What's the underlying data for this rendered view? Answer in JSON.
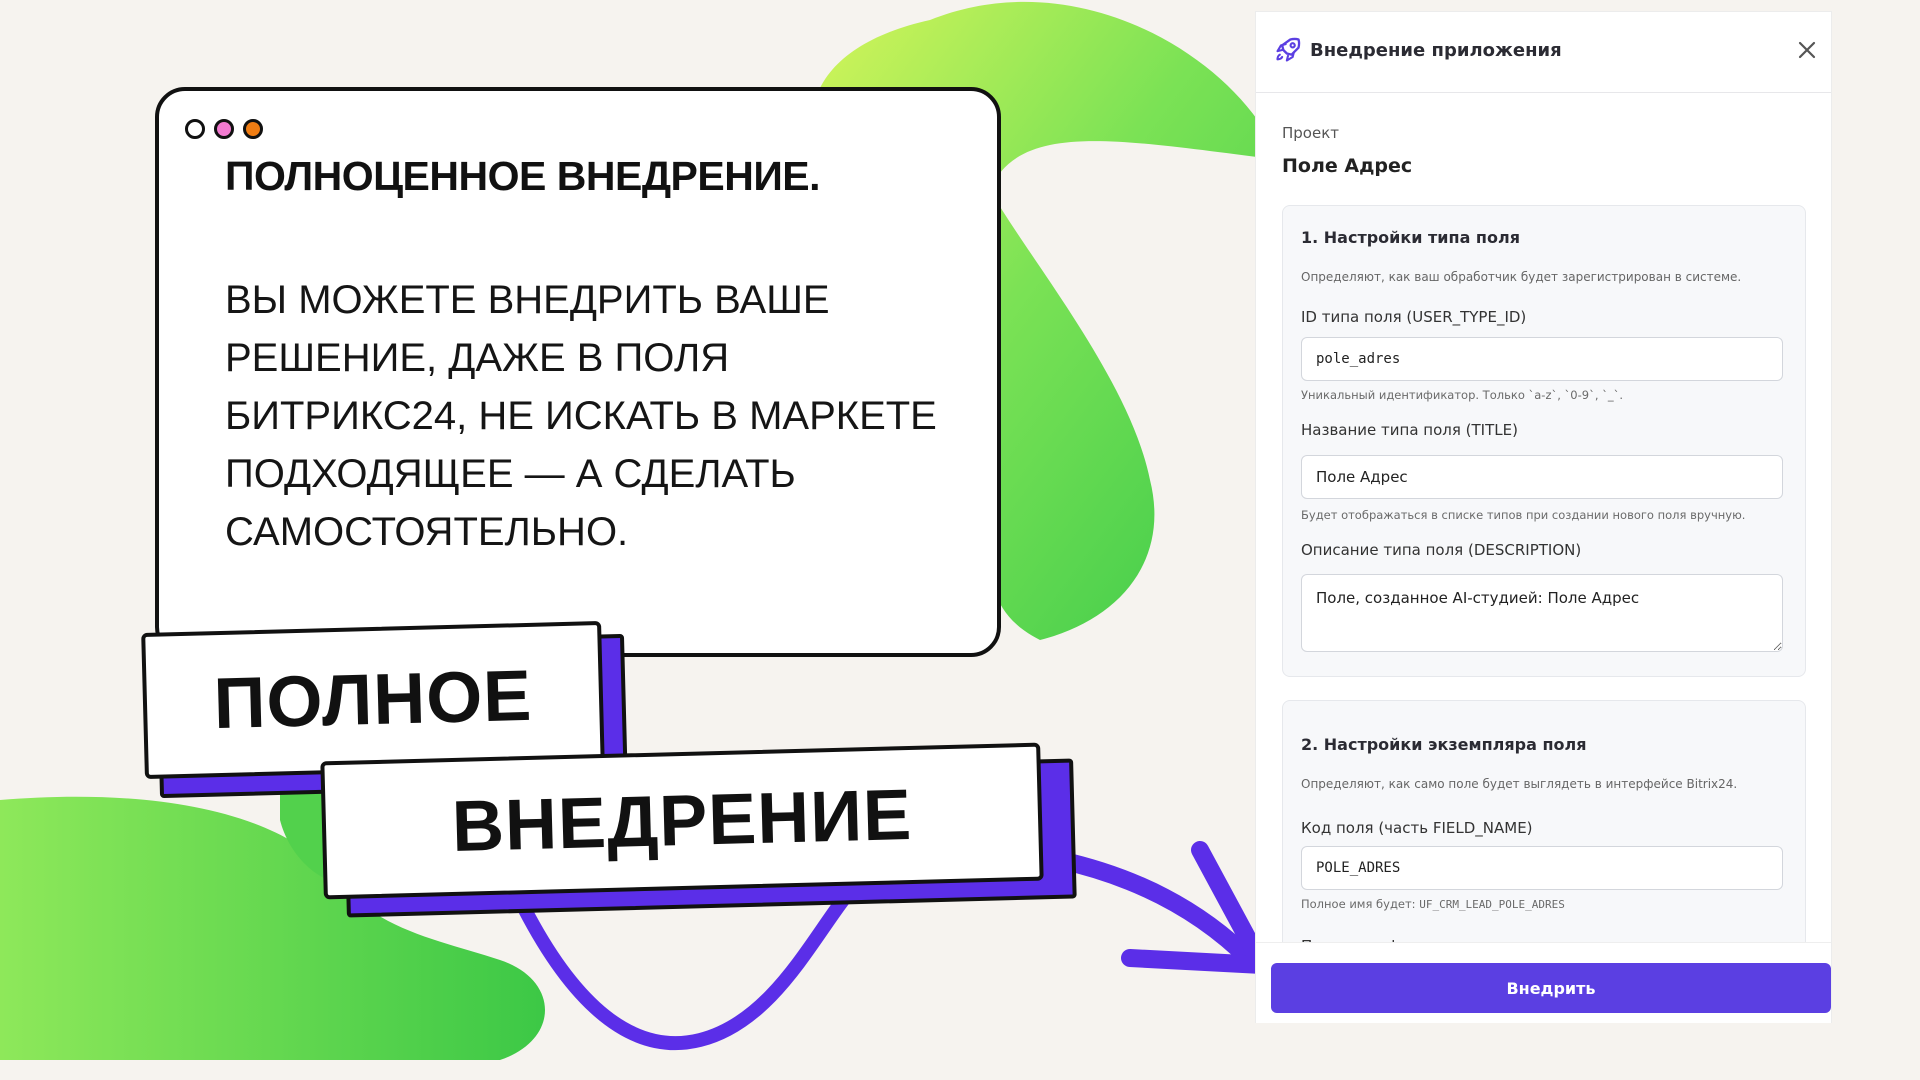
{
  "card": {
    "title": "Полноценное внедрение.",
    "body": "Вы можете внедрить ваше решение, даже в поля Битрикс24, не искать в маркете подходящее — а сделать самостоятельно.",
    "dot_colors": [
      "#ffffff",
      "#f27ad0",
      "#f07d13"
    ]
  },
  "stickers": {
    "first": "ПОЛНОЕ",
    "second": "ВНЕДРЕНИЕ"
  },
  "colors": {
    "accent": "#5b2ee8",
    "green": "#6fe04a",
    "button": "#5b3fe2"
  },
  "panel": {
    "title": "Внедрение приложения",
    "icons": {
      "title": "rocket-icon",
      "close": "close-icon"
    },
    "project_label": "Проект",
    "project_name": "Поле Адрес",
    "section1": {
      "title": "1. Настройки типа поля",
      "desc": "Определяют, как ваш обработчик будет зарегистрирован в системе.",
      "fields": [
        {
          "label": "ID типа поля (USER_TYPE_ID)",
          "value": "pole_adres",
          "hint": "Уникальный идентификатор. Только `a-z`, `0-9`, `_`."
        },
        {
          "label": "Название типа поля (TITLE)",
          "value": "Поле Адрес",
          "hint": "Будет отображаться в списке типов при создании нового поля вручную."
        },
        {
          "label": "Описание типа поля (DESCRIPTION)",
          "value": "Поле, созданное AI-студией: Поле Адрес"
        }
      ]
    },
    "section2": {
      "title": "2. Настройки экземпляра поля",
      "desc": "Определяют, как само поле будет выглядеть в интерфейсе Bitrix24.",
      "fields": [
        {
          "label": "Код поля (часть FIELD_NAME)",
          "value": "POLE_ADRES",
          "hint_prefix": "Полное имя будет:",
          "hint_code": "UF_CRM_LEAD_POLE_ADRES"
        },
        {
          "label": "Подпись в форме редактирования"
        }
      ]
    },
    "submit_label": "Внедрить"
  }
}
